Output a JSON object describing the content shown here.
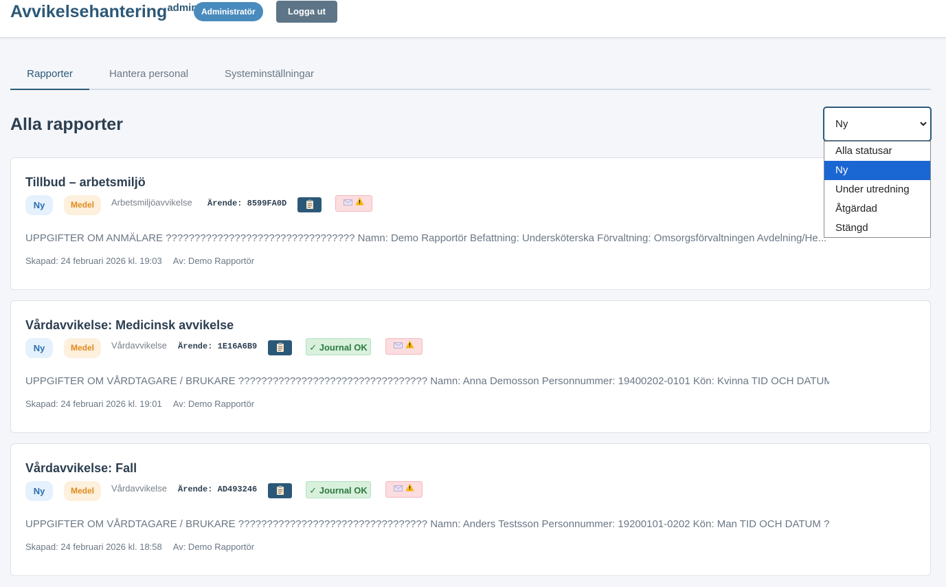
{
  "header": {
    "brand": "Avvikelsehantering",
    "brand_sup": "admin",
    "role": "Administratör",
    "logout": "Logga ut"
  },
  "tabs": [
    {
      "label": "Rapporter",
      "active": true
    },
    {
      "label": "Hantera personal",
      "active": false
    },
    {
      "label": "Systeminställningar",
      "active": false
    }
  ],
  "page_title": "Alla rapporter",
  "status_filter": {
    "selected": "Ny",
    "options": [
      "Alla statusar",
      "Ny",
      "Under utredning",
      "Åtgärdad",
      "Stängd"
    ]
  },
  "reports": [
    {
      "title": "Tillbud – arbetsmiljö",
      "status": "Ny",
      "priority": "Medel",
      "category": "Arbetsmiljöavvikelse",
      "case_label": "Ärende:",
      "case_id": "8599FA0D",
      "journal": "",
      "description": "UPPGIFTER OM ANMÄLARE ????????????????????????????????? Namn: Demo Rapportör Befattning: Undersköterska Förvaltning: Omsorgsförvaltningen Avdelning/He...",
      "created": "Skapad: 24 februari 2026 kl. 19:03",
      "author": "Av: Demo Rapportör"
    },
    {
      "title": "Vårdavvikelse: Medicinsk avvikelse",
      "status": "Ny",
      "priority": "Medel",
      "category": "Vårdavvikelse",
      "case_label": "Ärende:",
      "case_id": "1E16A6B9",
      "journal": "✓ Journal OK",
      "description": "UPPGIFTER OM VÅRDTAGARE / BRUKARE ????????????????????????????????? Namn: Anna Demosson Personnummer: 19400202-0101 Kön: Kvinna TID OCH DATUM ???????...",
      "created": "Skapad: 24 februari 2026 kl. 19:01",
      "author": "Av: Demo Rapportör"
    },
    {
      "title": "Vårdavvikelse: Fall",
      "status": "Ny",
      "priority": "Medel",
      "category": "Vårdavvikelse",
      "case_label": "Ärende:",
      "case_id": "AD493246",
      "journal": "✓ Journal OK",
      "description": "UPPGIFTER OM VÅRDTAGARE / BRUKARE ????????????????????????????????? Namn: Anders Testsson Personnummer: 19200101-0202 Kön: Man TID OCH DATUM ????????...",
      "created": "Skapad: 24 februari 2026 kl. 18:58",
      "author": "Av: Demo Rapportör"
    }
  ]
}
